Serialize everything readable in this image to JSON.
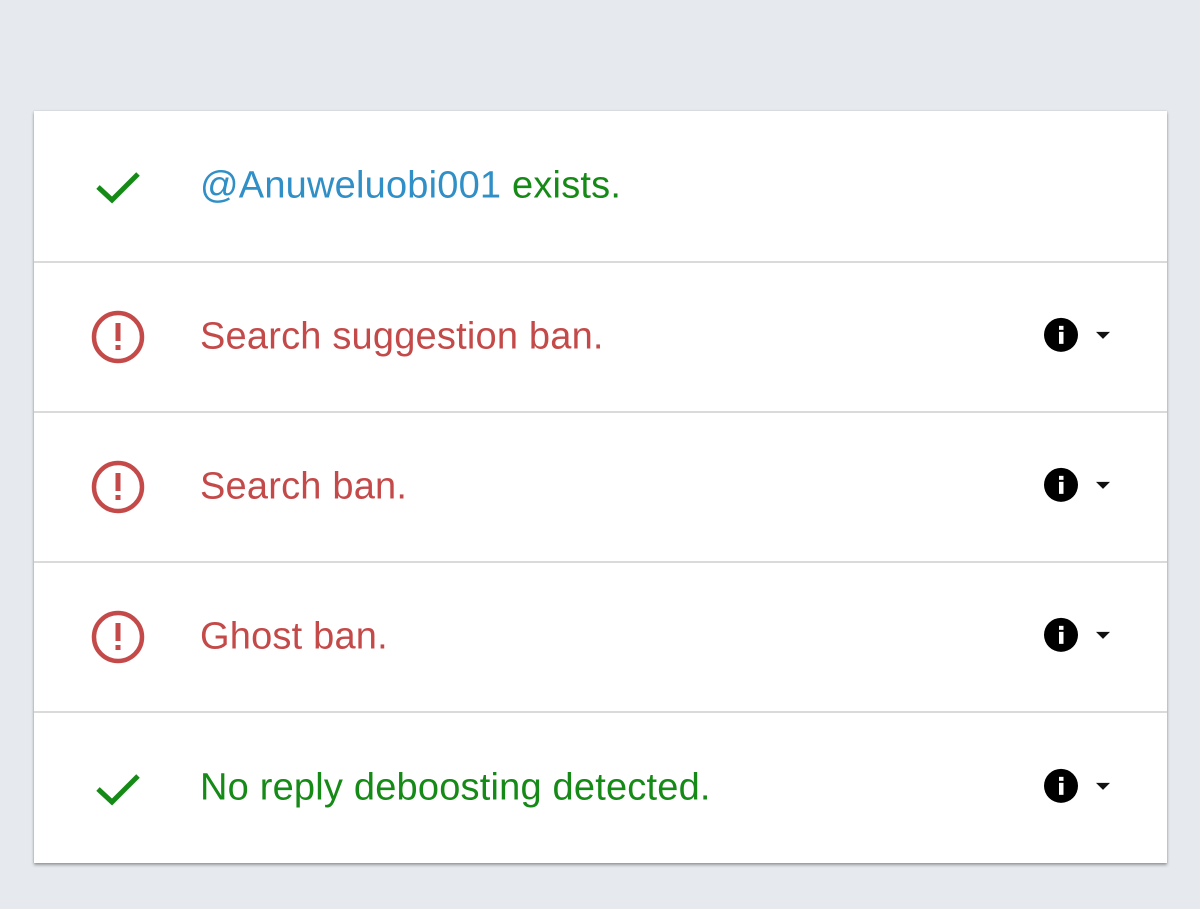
{
  "colors": {
    "ok": "#168a16",
    "bad": "#c44a4a",
    "handle": "#2f8fc6",
    "background": "#e6eaee"
  },
  "rows": [
    {
      "status": "ok",
      "icon": "checkmark-icon",
      "handle": "@Anuweluobi001",
      "text": " exists.",
      "has_controls": false
    },
    {
      "status": "bad",
      "icon": "alert-circle-icon",
      "text": "Search suggestion ban.",
      "has_controls": true,
      "info_icon": "info-icon",
      "expand_icon": "caret-down-icon"
    },
    {
      "status": "bad",
      "icon": "alert-circle-icon",
      "text": "Search ban.",
      "has_controls": true,
      "info_icon": "info-icon",
      "expand_icon": "caret-down-icon"
    },
    {
      "status": "bad",
      "icon": "alert-circle-icon",
      "text": "Ghost ban.",
      "has_controls": true,
      "info_icon": "info-icon",
      "expand_icon": "caret-down-icon"
    },
    {
      "status": "ok",
      "icon": "checkmark-icon",
      "text": "No reply deboosting detected.",
      "has_controls": true,
      "info_icon": "info-icon",
      "expand_icon": "caret-down-icon"
    }
  ]
}
